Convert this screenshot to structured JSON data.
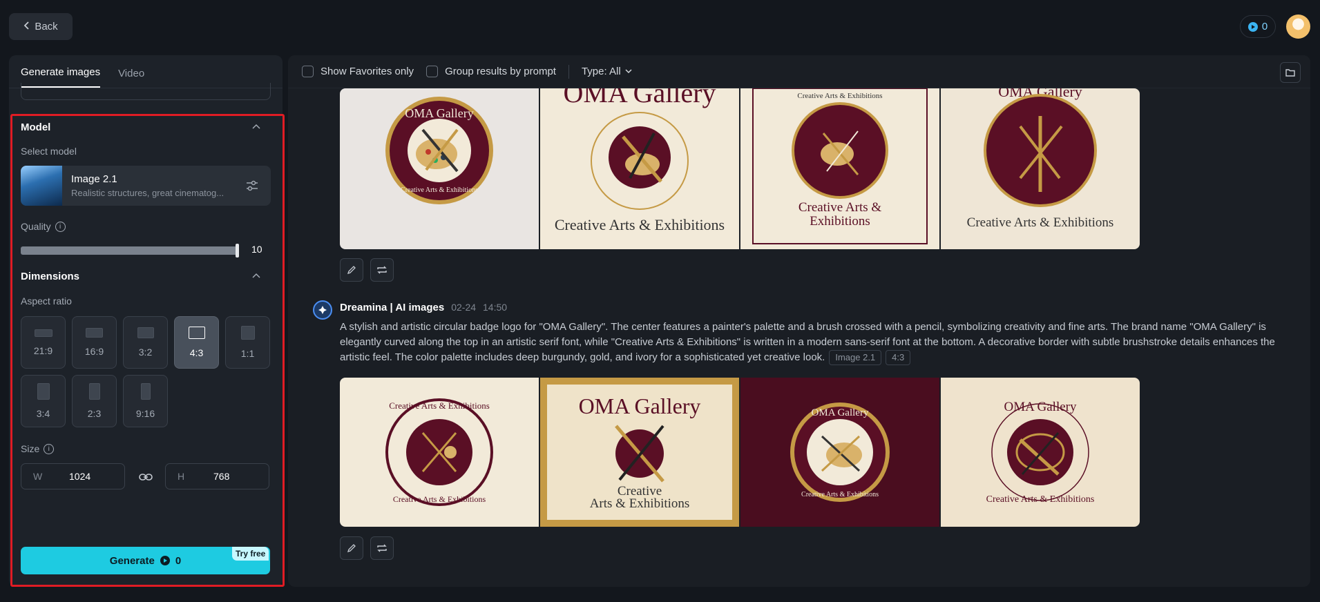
{
  "header": {
    "back_label": "Back",
    "credits": "0"
  },
  "left_panel": {
    "tabs": [
      {
        "label": "Generate images",
        "active": true
      },
      {
        "label": "Video",
        "active": false
      }
    ],
    "model_section": {
      "title": "Model",
      "select_label": "Select model",
      "model_name": "Image 2.1",
      "model_desc": "Realistic structures, great cinematog..."
    },
    "quality": {
      "label": "Quality",
      "value": "10",
      "fraction": 0.97
    },
    "dimensions": {
      "title": "Dimensions",
      "aspect_label": "Aspect ratio",
      "ratios": [
        "21:9",
        "16:9",
        "3:2",
        "4:3",
        "1:1",
        "3:4",
        "2:3",
        "9:16"
      ],
      "selected": "4:3",
      "size_label": "Size",
      "width_prefix": "W",
      "width_value": "1024",
      "height_prefix": "H",
      "height_value": "768"
    },
    "generate": {
      "label": "Generate",
      "cost": "0",
      "badge": "Try free"
    }
  },
  "toolbar": {
    "favorites_label": "Show Favorites only",
    "group_label": "Group results by prompt",
    "type_label": "Type: All"
  },
  "result": {
    "author": "Dreamina | AI images",
    "date": "02-24",
    "time": "14:50",
    "prompt": "A stylish and artistic circular badge logo for \"OMA Gallery\". The center features a painter's palette and a brush crossed with a pencil, symbolizing creativity and fine arts. The brand name \"OMA Gallery\" is elegantly curved along the top in an artistic serif font, while \"Creative Arts & Exhibitions\" is written in a modern sans-serif font at the bottom. A decorative border with subtle brushstroke details enhances the artistic feel. The color palette includes deep burgundy, gold, and ivory for a sophisticated yet creative look.",
    "model_chip": "Image 2.1",
    "ratio_chip": "4:3"
  },
  "images": {
    "brand": "OMA Gallery",
    "tagline": "Creative Arts & Exhibitions",
    "tagline_line1": "Creative Arts &",
    "tagline_line2": "Exhibitions",
    "tagline_alt1": "Creative",
    "tagline_alt2": "Arts & Exhibitions"
  },
  "colors": {
    "burgundy": "#5a0f25",
    "gold": "#c59a45",
    "ivory": "#f2ead9",
    "accent": "#1ecbe1",
    "highlight": "#e01c24"
  }
}
